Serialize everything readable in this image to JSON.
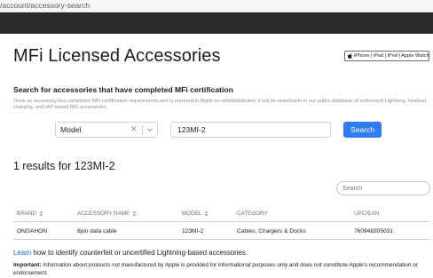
{
  "browser": {
    "url": "/account/accessory-search"
  },
  "header": {
    "title": "MFi Licensed Accessories",
    "badge": {
      "logo": "Made for",
      "text": "iPhone | iPad | iPod | Apple Watch"
    }
  },
  "search": {
    "heading": "Search for accessories that have completed MFi certification",
    "description": "Once an accessory has completed MFi certification requirements and is reported to Apple as sold/distributed, it will be searchable in our public database of authorized Lightning, headset, charging, and iAP-based MFi accessories.",
    "field_select": {
      "selected": "Model",
      "clear_icon": "clear-x-icon",
      "dropdown_icon": "chevron-down-icon"
    },
    "query_value": "123MI-2",
    "button_label": "Search"
  },
  "results": {
    "summary": "1 results for 123MI-2",
    "table_search_placeholder": "Search",
    "columns": [
      "BRAND",
      "ACCESSORY NAME",
      "MODEL",
      "CATEGORY",
      "UPC/EAN"
    ],
    "rows": [
      {
        "brand": "ONGAHON",
        "name": "8pin data cable",
        "model": "123MI-2",
        "category": "Cables, Chargers & Docks",
        "upc": "760948305031"
      }
    ]
  },
  "footer": {
    "learn_link": "Learn",
    "learn_rest": " how to identify counterfeit or uncertified Lightning-based accessories.",
    "important_label": "Important:",
    "important_text": " Information about products not manufactured by Apple is provided for informational purposes only and does not constitute Apple's recommendation or endorsement."
  },
  "colors": {
    "accent": "#2f7cf6",
    "link": "#1a66d2",
    "top_bar": "#2a2a2a"
  }
}
